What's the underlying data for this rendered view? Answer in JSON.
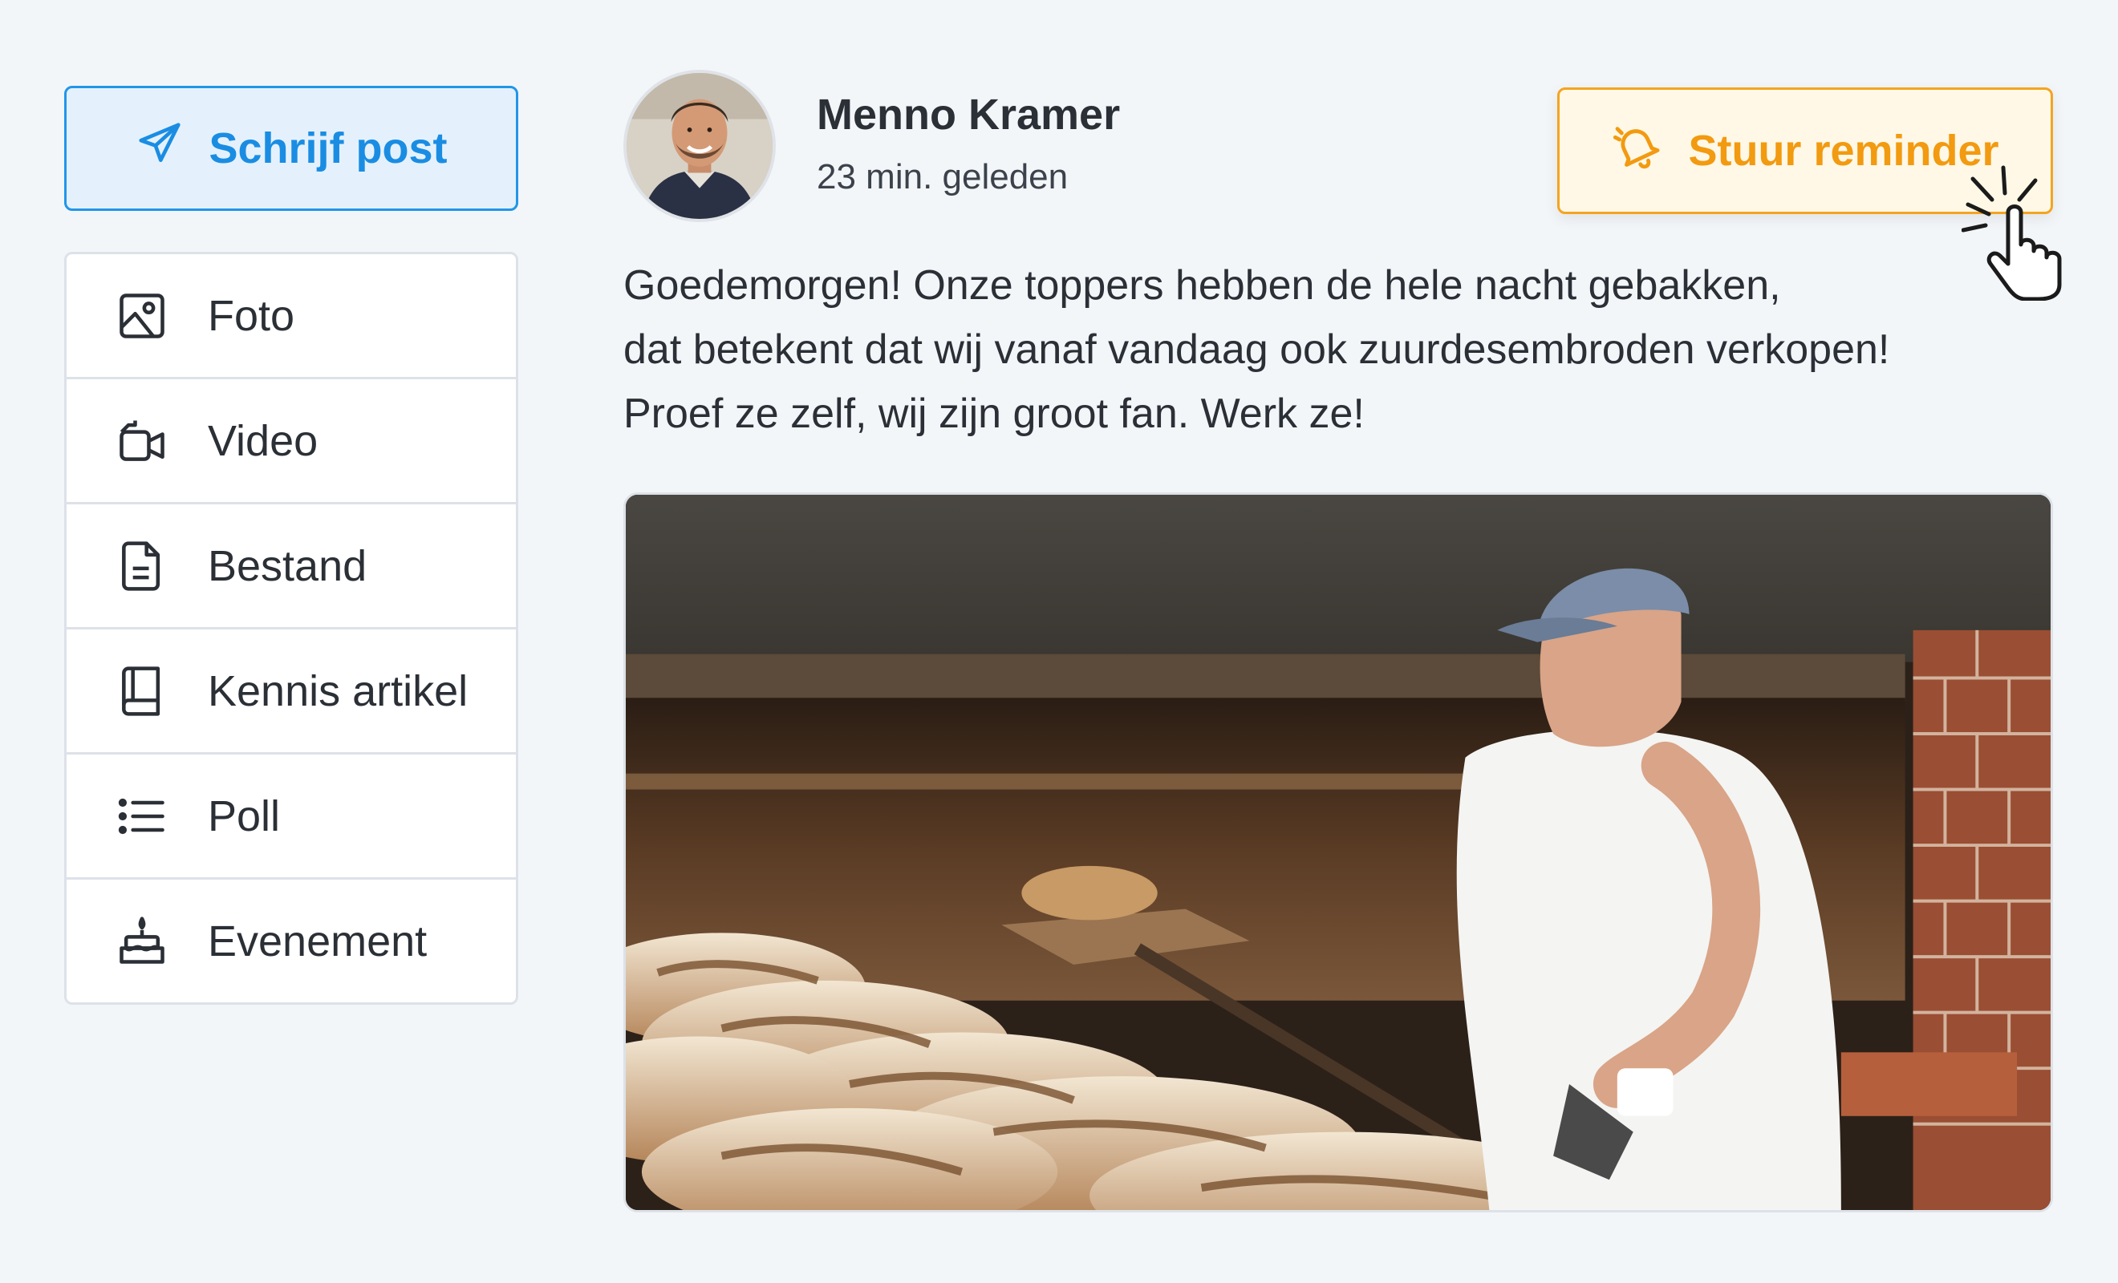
{
  "composer": {
    "write_label": "Schrijf post",
    "menu": [
      {
        "label": "Foto",
        "icon": "image-icon"
      },
      {
        "label": "Video",
        "icon": "video-camera-icon"
      },
      {
        "label": "Bestand",
        "icon": "document-icon"
      },
      {
        "label": "Kennis artikel",
        "icon": "book-icon"
      },
      {
        "label": "Poll",
        "icon": "list-icon"
      },
      {
        "label": "Evenement",
        "icon": "cake-icon"
      }
    ]
  },
  "post": {
    "author": "Menno Kramer",
    "time": "23 min. geleden",
    "reminder_label": "Stuur reminder",
    "text_lines": [
      "Goedemorgen! Onze toppers hebben de hele nacht gebakken,",
      "dat betekent dat wij vanaf vandaag ook zuurdesembroden verkopen!",
      "Proef ze zelf, wij zijn groot fan. Werk ze!"
    ]
  },
  "colors": {
    "primary": "#1a8de3",
    "reminder": "#f29a10",
    "background": "#f3f6f9"
  }
}
